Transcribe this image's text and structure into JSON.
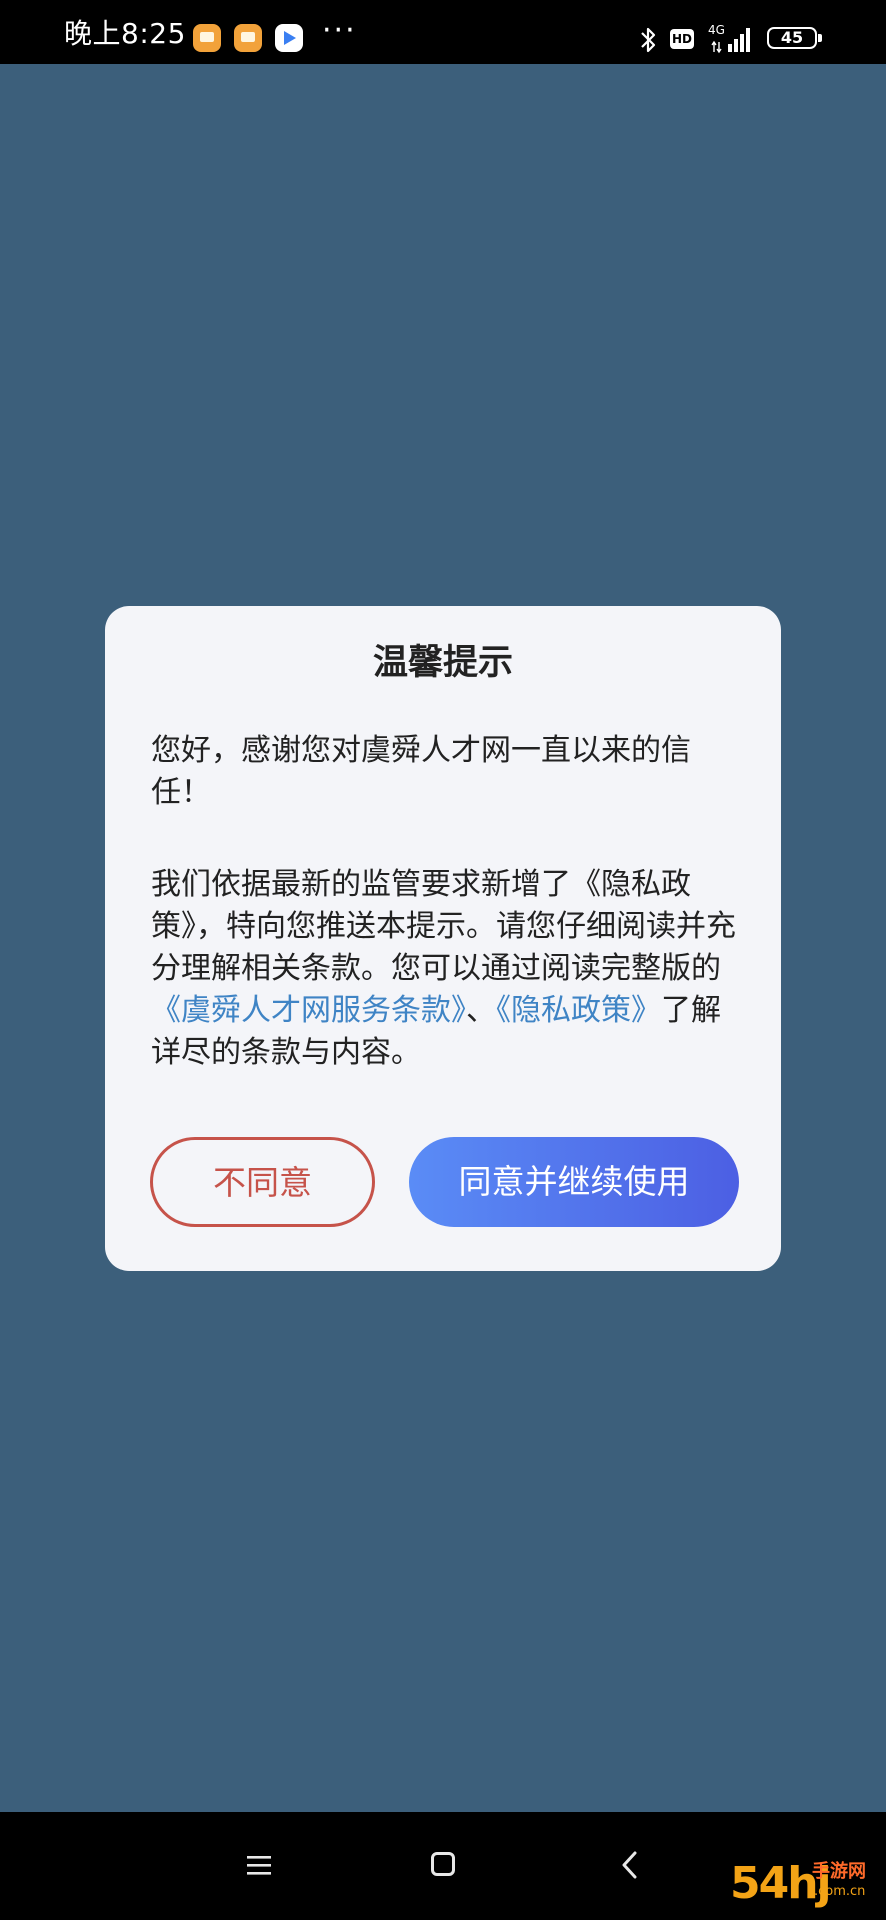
{
  "status_bar": {
    "time": "晚上8:25",
    "more": "···",
    "hd": "HD",
    "network": "4G",
    "battery": "45"
  },
  "dialog": {
    "title": "温馨提示",
    "para1": "您好，感谢您对虞舜人才网一直以来的信任！",
    "para2_text1": "我们依据最新的监管要求新增了《隐私政策》，特向您推送本提示。请您仔细阅读并充分理解相关条款。您可以通过阅读完整版的",
    "link_terms": "《虞舜人才网服务条款》",
    "separator": "、",
    "link_privacy": "《隐私政策》",
    "para2_text2": "了解详尽的条款与内容。",
    "disagree_label": "不同意",
    "agree_label": "同意并继续使用"
  },
  "watermark": {
    "big": "54hj",
    "small_top": "手游网",
    "small_bottom": ".com.cn"
  },
  "colors": {
    "overlay_background": "#3c5f7b",
    "dialog_background": "#f4f5f9",
    "link": "#3f84c5",
    "disagree": "#c6534a",
    "agree_start": "#5a8cf6",
    "agree_end": "#4c5fe3"
  },
  "icons": {
    "status": [
      "bluetooth-icon",
      "hd-icon",
      "signal-icon",
      "battery-icon"
    ],
    "nav": [
      "menu-icon",
      "home-icon",
      "back-icon"
    ]
  }
}
